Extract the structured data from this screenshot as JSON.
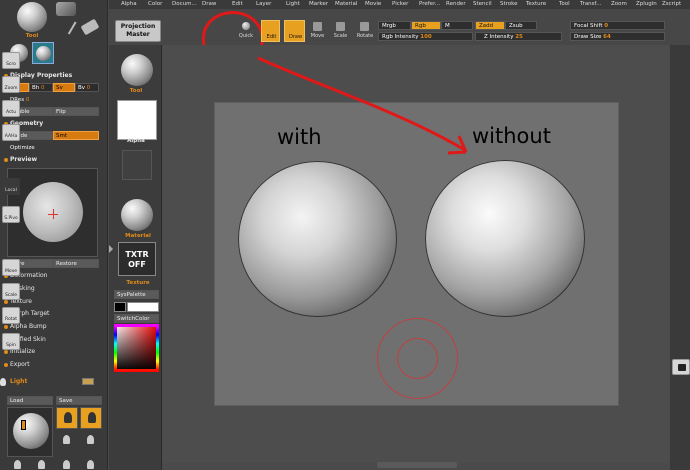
{
  "top_menu": [
    "Alpha",
    "Color",
    "Docum...",
    "Draw",
    "Edit",
    "Layer",
    "Light",
    "Marker",
    "Material",
    "Movie",
    "Picker",
    "Prefer...",
    "Render",
    "Stencil",
    "Stroke",
    "Texture",
    "Tool",
    "Transf...",
    "Zoom",
    "Zplugin",
    "Zscript"
  ],
  "shelf": {
    "projection_master": "Projection Master",
    "quick": "Quick",
    "edit": "Edit",
    "draw": "Draw",
    "move": "Move",
    "scale": "Scale",
    "rotate": "Rotate",
    "mrgb": "Mrgb",
    "rgb": "Rgb",
    "m": "M",
    "zadd": "Zadd",
    "zsub": "Zsub",
    "rgb_intensity_label": "Rgb Intensity",
    "rgb_intensity_value": "100",
    "z_intensity_label": "Z Intensity",
    "z_intensity_value": "25",
    "focal_shift_label": "Focal Shift",
    "focal_shift_value": "0",
    "draw_size_label": "Draw Size",
    "draw_size_value": "64"
  },
  "left_panel": {
    "tool_label": "Tool",
    "display_properties": "Display Properties",
    "rh": "Rh",
    "bh": "Bh",
    "bh_val": "0",
    "sv": "Sv",
    "bv": "Bv",
    "bv_val": "0",
    "dres": "DRes",
    "dres_val": "0",
    "double": "Double",
    "flip": "Flip",
    "geometry": "Geometry",
    "divide": "Divide",
    "smt": "Smt",
    "optimize": "Optimize",
    "preview": "Preview",
    "store": "Store",
    "restore": "Restore",
    "items": [
      "Deformation",
      "Masking",
      "Texture",
      "Morph Target",
      "Alpha Bump",
      "Unified Skin",
      "Initialize",
      "Export"
    ],
    "light": "Light",
    "load": "Load",
    "save": "Save"
  },
  "col2": {
    "tool": "Tool",
    "alpha": "Alpha",
    "material": "Material",
    "txtr_off": "TXTR OFF",
    "texture": "Texture",
    "syspalette": "SysPalette",
    "switchcolor": "SwitchColor"
  },
  "canvas": {
    "label_with": "with",
    "label_without": "without"
  },
  "right_shelf": [
    "Scro",
    "Zoom",
    "Actu",
    "AAHa",
    "Local",
    "S.Pivo",
    "Move",
    "Scale",
    "Rotat",
    "Spin"
  ]
}
